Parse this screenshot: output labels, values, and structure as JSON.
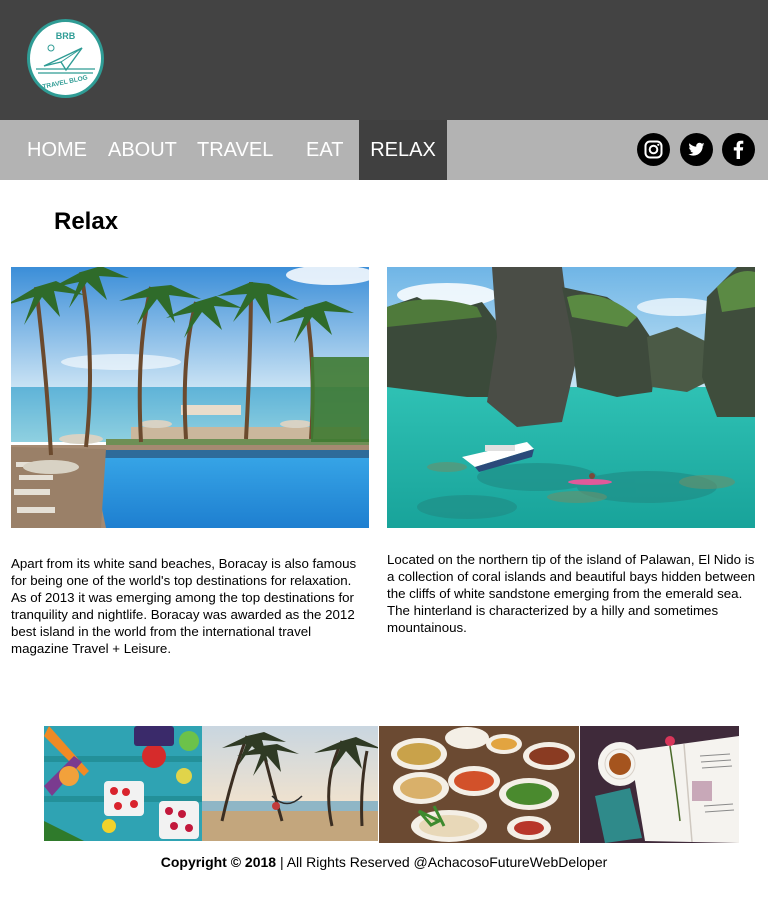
{
  "logo": {
    "top_text": "BRB",
    "bottom_text": "TRAVEL BLOG"
  },
  "nav": {
    "items": [
      {
        "label": "HOME"
      },
      {
        "label": "ABOUT"
      },
      {
        "label": "TRAVEL"
      },
      {
        "label": "EAT"
      },
      {
        "label": "RELAX",
        "active": true
      }
    ],
    "social_icons": [
      "instagram-icon",
      "twitter-icon",
      "facebook-icon"
    ]
  },
  "page": {
    "title": "Relax"
  },
  "articles": [
    {
      "image": "boracay-resort-pool-photo",
      "text": "Apart from its white sand beaches, Boracay is also famous for being one of the world's top destinations for relaxation. As of 2013 it was emerging among the top destinations for tranquility and nightlife. Boracay was awarded as the 2012 best island in the world from the international travel magazine Travel + Leisure."
    },
    {
      "image": "el-nido-lagoon-photo",
      "text": "Located on the northern tip of the island of Palawan, El Nido is a collection of coral islands and beautiful bays hidden between the cliffs of white sandstone emerging from the emerald sea. The hinterland is characterized by a hilly and sometimes mountainous."
    }
  ],
  "gallery": [
    "vegetables-photo",
    "palm-beach-photo",
    "food-spread-photo",
    "tea-and-book-photo"
  ],
  "footer": {
    "copyright": "Copyright © 2018",
    "rest": " | All Rights Reserved @AchacosoFutureWebDeloper"
  },
  "colors": {
    "header_bg": "#434343",
    "nav_bg": "#b3b3b3",
    "nav_active_bg": "#404040",
    "logo_ring": "#2f9c95"
  }
}
